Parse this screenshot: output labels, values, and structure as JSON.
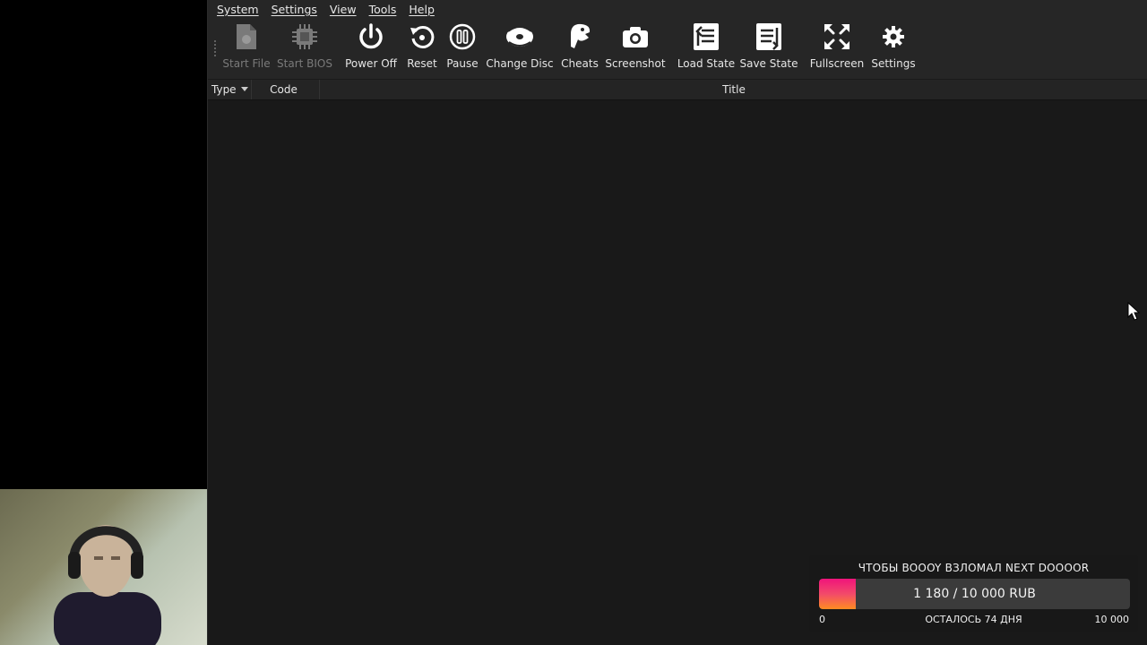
{
  "menu": [
    "System",
    "Settings",
    "View",
    "Tools",
    "Help"
  ],
  "toolbar": {
    "start_file": "Start File",
    "start_bios": "Start BIOS",
    "power_off": "Power Off",
    "reset": "Reset",
    "pause": "Pause",
    "change_disc": "Change Disc",
    "cheats": "Cheats",
    "screenshot": "Screenshot",
    "load_state": "Load State",
    "save_state": "Save State",
    "fullscreen": "Fullscreen",
    "settings": "Settings"
  },
  "columns": {
    "type": "Type",
    "code": "Code",
    "title": "Title"
  },
  "donation": {
    "title": "ЧТОБЫ BOOOY ВЗЛОМАЛ NEXT DOOOOR",
    "progress_text": "1 180 / 10 000 RUB",
    "current": 1180,
    "goal": 10000,
    "min_label": "0",
    "max_label": "10 000",
    "remaining": "ОСТАЛОСЬ 74 ДНЯ"
  },
  "colors": {
    "app_bg": "#191919",
    "toolbar_bg": "#262626",
    "bar_pink": "#f0147c",
    "bar_orange": "#ff8c22"
  }
}
